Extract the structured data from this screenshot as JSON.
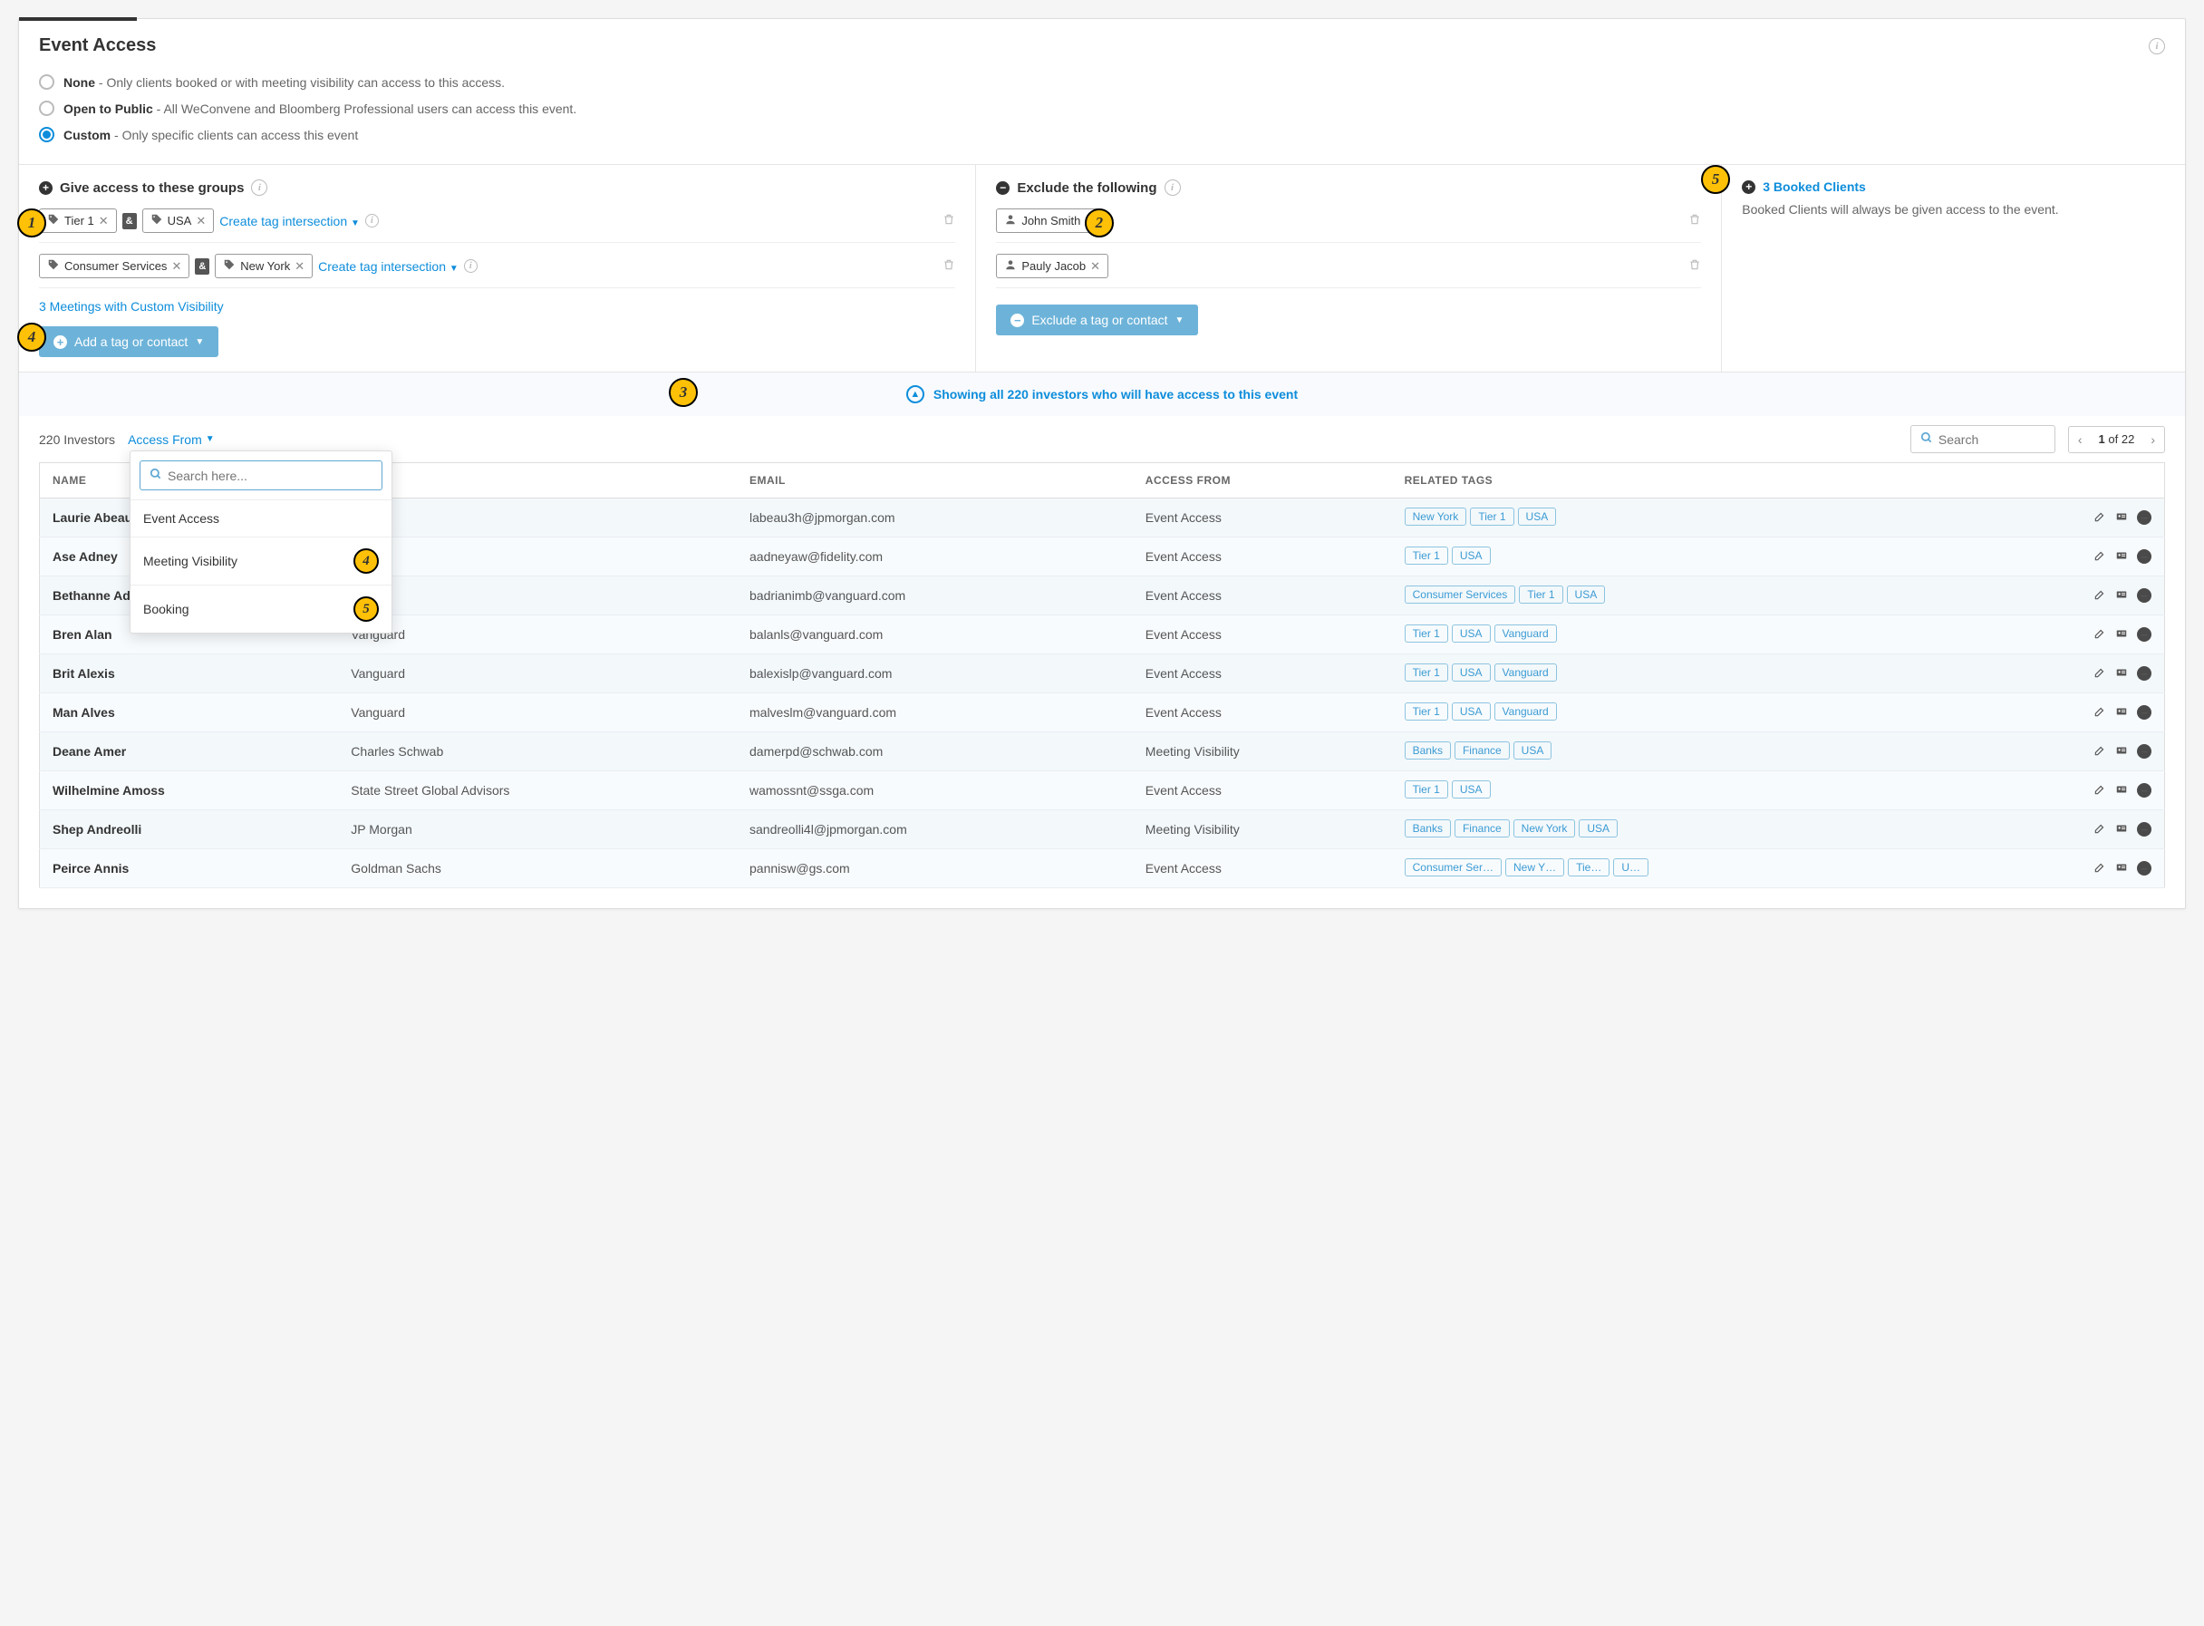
{
  "header": {
    "title": "Event Access"
  },
  "access_options": [
    {
      "value": "none",
      "label": "None",
      "desc": "- Only clients booked or with meeting visibility can access to this access.",
      "checked": false
    },
    {
      "value": "public",
      "label": "Open to Public",
      "desc": "- All WeConvene and Bloomberg Professional users can access this event.",
      "checked": false
    },
    {
      "value": "custom",
      "label": "Custom",
      "desc": "- Only specific clients can access this event",
      "checked": true
    }
  ],
  "groups": {
    "title": "Give access to these groups",
    "rows": [
      {
        "tags": [
          "Tier 1",
          "USA"
        ],
        "link": "Create tag intersection"
      },
      {
        "tags": [
          "Consumer Services",
          "New York"
        ],
        "link": "Create tag intersection"
      }
    ],
    "meetings_link": "3 Meetings with Custom Visibility",
    "add_btn": "Add a tag or contact",
    "and_label": "&"
  },
  "exclude": {
    "title": "Exclude the following",
    "contacts": [
      "John Smith",
      "Pauly Jacob"
    ],
    "btn": "Exclude a tag or contact"
  },
  "booked": {
    "link": "3 Booked Clients",
    "desc": "Booked Clients will always be given access to the event."
  },
  "toggle_text": "Showing all 220 investors who will have access to this event",
  "table": {
    "count_label": "220 Investors",
    "filter_label": "Access From",
    "search_placeholder": "Search",
    "page_current": "1",
    "page_total": "of 22",
    "columns": [
      "NAME",
      "",
      "EMAIL",
      "ACCESS FROM",
      "RELATED TAGS",
      ""
    ],
    "rows": [
      {
        "name": "Laurie Abeau",
        "company": "",
        "email": "labeau3h@jpmorgan.com",
        "access": "Event Access",
        "tags": [
          "New York",
          "Tier 1",
          "USA"
        ]
      },
      {
        "name": "Ase Adney",
        "company": "",
        "email": "aadneyaw@fidelity.com",
        "access": "Event Access",
        "tags": [
          "Tier 1",
          "USA"
        ]
      },
      {
        "name": "Bethanne Ad",
        "company": "",
        "email": "badrianimb@vanguard.com",
        "access": "Event Access",
        "tags": [
          "Consumer Services",
          "Tier 1",
          "USA"
        ]
      },
      {
        "name": "Bren Alan",
        "company": "Vanguard",
        "email": "balanls@vanguard.com",
        "access": "Event Access",
        "tags": [
          "Tier 1",
          "USA",
          "Vanguard"
        ]
      },
      {
        "name": "Brit Alexis",
        "company": "Vanguard",
        "email": "balexislp@vanguard.com",
        "access": "Event Access",
        "tags": [
          "Tier 1",
          "USA",
          "Vanguard"
        ]
      },
      {
        "name": "Man Alves",
        "company": "Vanguard",
        "email": "malveslm@vanguard.com",
        "access": "Event Access",
        "tags": [
          "Tier 1",
          "USA",
          "Vanguard"
        ]
      },
      {
        "name": "Deane Amer",
        "company": "Charles Schwab",
        "email": "damerpd@schwab.com",
        "access": "Meeting Visibility",
        "tags": [
          "Banks",
          "Finance",
          "USA"
        ]
      },
      {
        "name": "Wilhelmine Amoss",
        "company": "State Street Global Advisors",
        "email": "wamossnt@ssga.com",
        "access": "Event Access",
        "tags": [
          "Tier 1",
          "USA"
        ]
      },
      {
        "name": "Shep Andreolli",
        "company": "JP Morgan",
        "email": "sandreolli4l@jpmorgan.com",
        "access": "Meeting Visibility",
        "tags": [
          "Banks",
          "Finance",
          "New York",
          "USA"
        ]
      },
      {
        "name": "Peirce Annis",
        "company": "Goldman Sachs",
        "email": "pannisw@gs.com",
        "access": "Event Access",
        "tags": [
          "Consumer Ser…",
          "New Y…",
          "Tie…",
          "U…"
        ]
      }
    ]
  },
  "dropdown": {
    "search_placeholder": "Search here...",
    "items": [
      "Event Access",
      "Meeting Visibility",
      "Booking"
    ]
  },
  "callouts": {
    "c1": "1",
    "c2": "2",
    "c3": "3",
    "c4": "4",
    "c5": "5"
  }
}
